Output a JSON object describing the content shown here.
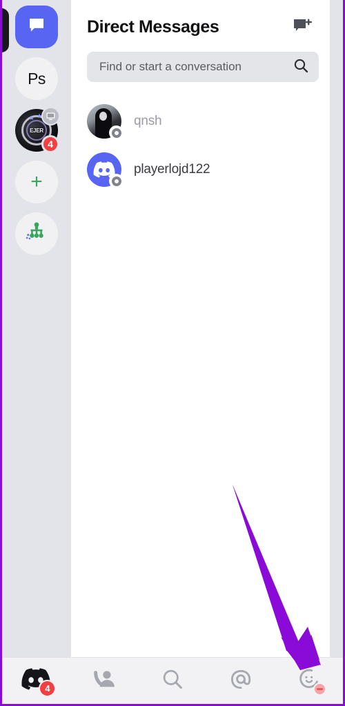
{
  "window": {
    "title": "Direct Messages",
    "accent_border_color": "#8A0BD8",
    "rail_bg": "#E3E4E9",
    "panel_bg": "#FFFFFF"
  },
  "server_rail": {
    "items": [
      {
        "id": "cut-off-server",
        "name": "partially-visible-server",
        "label": "",
        "kind": "cutoff"
      },
      {
        "id": "direct-messages",
        "name": "direct-messages-tab",
        "label": "",
        "icon": "speech-bubble-icon",
        "kind": "dm",
        "active": true,
        "color": "#5865F2"
      },
      {
        "id": "ps-server",
        "name": "server-ps",
        "label": "Ps",
        "kind": "initials"
      },
      {
        "id": "ejer-server",
        "name": "server-ejer",
        "label": "EJER",
        "kind": "artwork",
        "screen_badge": "screen-share-icon",
        "unread_count": "4"
      },
      {
        "id": "add-server",
        "name": "add-server-button",
        "label": "+",
        "kind": "add",
        "color": "#3BA55D"
      },
      {
        "id": "explore-servers",
        "name": "explore-servers-button",
        "label": "",
        "icon": "server-network-icon",
        "kind": "explore",
        "color": "#3BA55D"
      }
    ]
  },
  "header": {
    "title": "Direct Messages",
    "new_dm_icon": "new-message-icon"
  },
  "search": {
    "placeholder": "Find or start a conversation",
    "icon": "search-icon",
    "value": ""
  },
  "dm_list": {
    "items": [
      {
        "name": "qnsh",
        "avatar_type": "photo",
        "status": "offline",
        "unread": false
      },
      {
        "name": "playerlojd122",
        "avatar_type": "clyde",
        "status": "offline",
        "unread": true
      }
    ]
  },
  "bottom_nav": {
    "tabs": [
      {
        "id": "home",
        "label": "",
        "icon": "discord-logo-icon",
        "badge": "4",
        "active": true
      },
      {
        "id": "friends",
        "label": "",
        "icon": "person-wave-icon",
        "badge": "",
        "active": false
      },
      {
        "id": "search",
        "label": "",
        "icon": "search-icon",
        "badge": "",
        "active": false
      },
      {
        "id": "mentions",
        "label": "",
        "icon": "at-mention-icon",
        "badge": "",
        "active": false
      },
      {
        "id": "profile",
        "label": "",
        "icon": "smiley-face-icon",
        "badge": "",
        "status": "dnd",
        "active": false
      }
    ]
  },
  "annotation": {
    "arrow_color": "#8A0BD8",
    "points_to": "profile-tab"
  }
}
